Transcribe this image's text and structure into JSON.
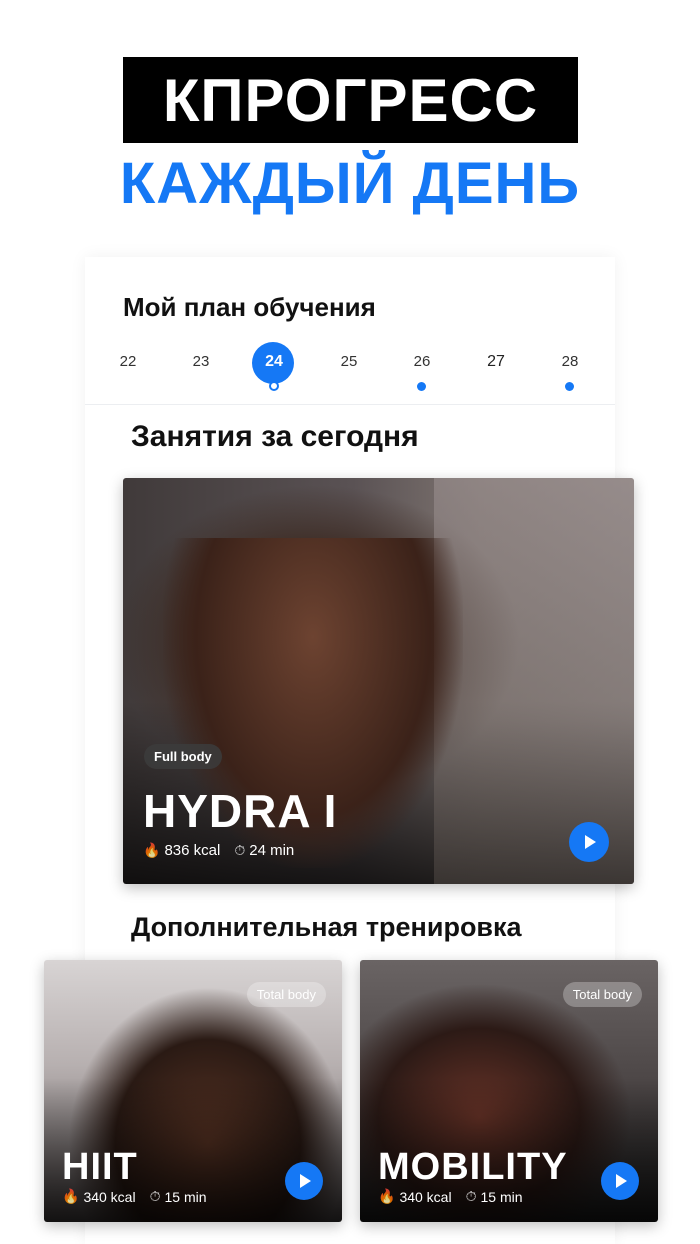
{
  "hero": {
    "title": "КПРОГРЕСС",
    "subtitle": "КАЖДЫЙ ДЕНЬ"
  },
  "plan": {
    "title": "Мой план обучения",
    "days": [
      "22",
      "23",
      "24",
      "25",
      "26",
      "27",
      "28"
    ],
    "selected_day": "24"
  },
  "today": {
    "title": "Занятия за сегодня",
    "workout": {
      "tag": "Full body",
      "name": "HYDRA I",
      "kcal": "836 kcal",
      "duration": "24 min"
    }
  },
  "extra": {
    "title": "Дополнительная тренировка",
    "workouts": [
      {
        "tag": "Total body",
        "name": "HIIT",
        "kcal": "340 kcal",
        "duration": "15 min"
      },
      {
        "tag": "Total body",
        "name": "MOBILITY",
        "kcal": "340 kcal",
        "duration": "15 min"
      }
    ]
  },
  "colors": {
    "accent": "#1578f5",
    "hero_bg": "#000000"
  },
  "icons": {
    "calories": "flame-icon",
    "time": "stopwatch-icon",
    "play": "play-icon"
  }
}
